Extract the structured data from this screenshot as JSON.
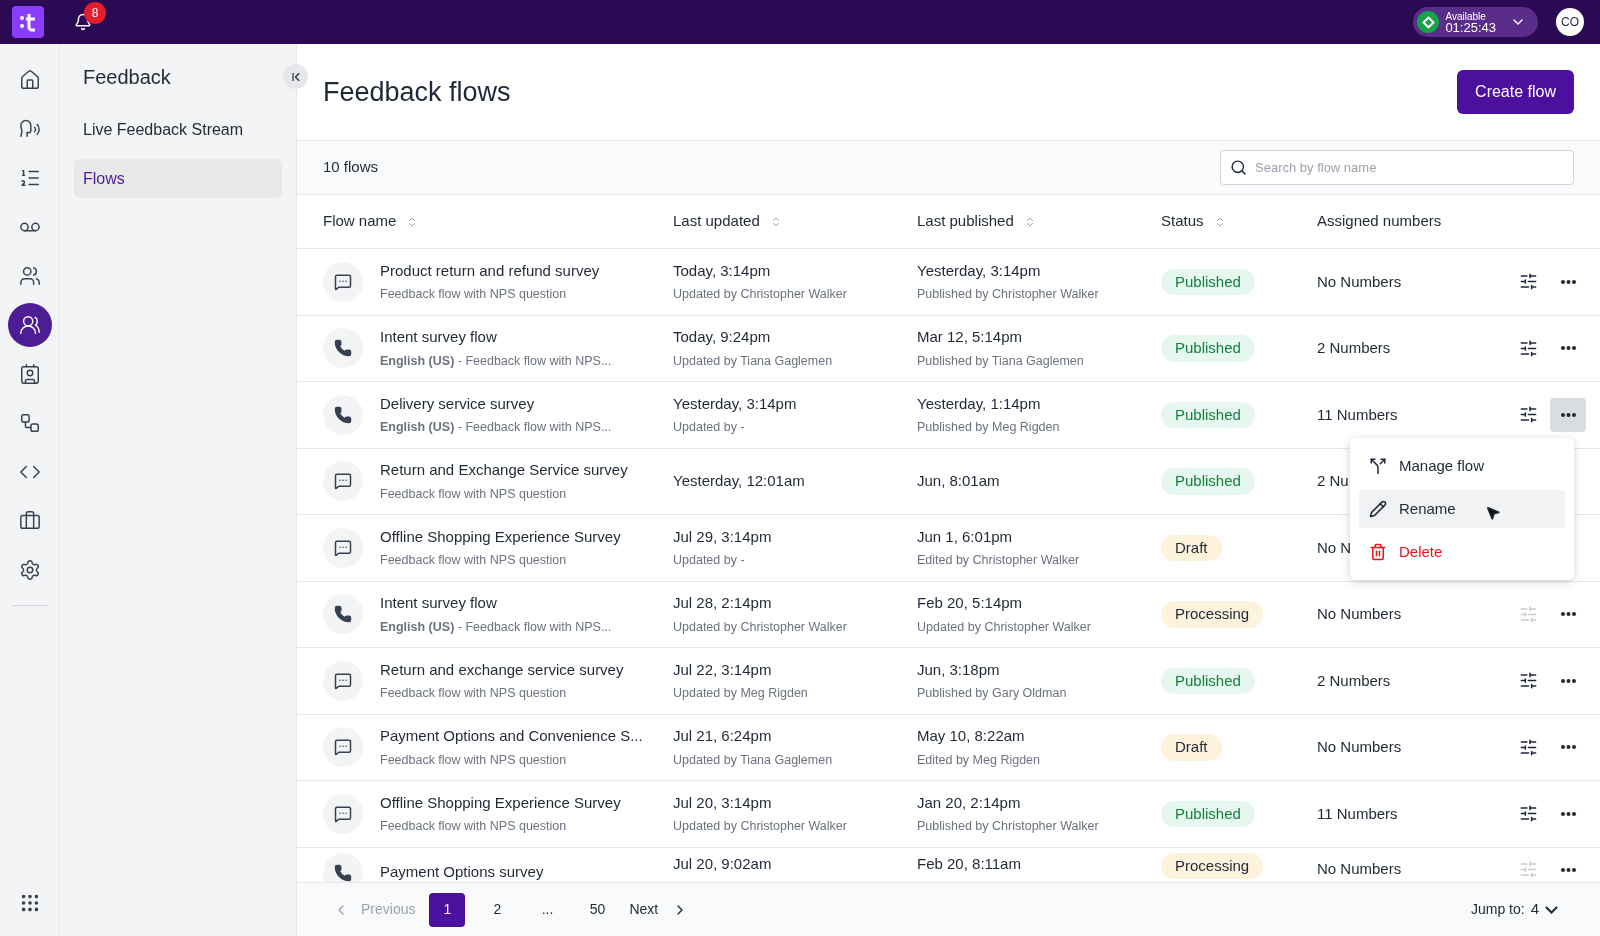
{
  "top_bar": {
    "notification_count": "8",
    "presence": {
      "label": "Available",
      "timer": "01:25:43"
    },
    "avatar": "CO"
  },
  "rail": {
    "items": [
      {
        "selected": false
      },
      {
        "selected": false
      },
      {
        "selected": false
      },
      {
        "selected": false
      },
      {
        "selected": false
      },
      {
        "selected": true
      },
      {
        "selected": false
      },
      {
        "selected": false
      },
      {
        "selected": false
      },
      {
        "selected": false
      },
      {
        "selected": false
      }
    ]
  },
  "sidebar": {
    "title": "Feedback",
    "items": [
      {
        "label": "Live Feedback Stream",
        "selected": false
      },
      {
        "label": "Flows",
        "selected": true
      }
    ]
  },
  "page": {
    "title": "Feedback flows",
    "create_button": "Create flow",
    "count": "10 flows",
    "search": {
      "placeholder": "Search by flow name"
    }
  },
  "table": {
    "columns": [
      {
        "label": "Flow name",
        "sortable": true
      },
      {
        "label": "Last updated",
        "sortable": true
      },
      {
        "label": "Last published",
        "sortable": true
      },
      {
        "label": "Status",
        "sortable": true
      },
      {
        "label": "Assigned numbers",
        "sortable": false
      }
    ],
    "rows": [
      {
        "kind": "chat",
        "name": "Product return and refund survey",
        "description": "Feedback flow with NPS question",
        "updated": "Today, 3:14pm",
        "updated_by": "Updated by Christopher Walker",
        "published": "Yesterday, 3:14pm",
        "published_by": "Published by Christopher Walker",
        "status": {
          "label": "Published",
          "kind": "published"
        },
        "numbers": "No Numbers",
        "settings_disabled": false,
        "menu_open": false
      },
      {
        "kind": "phone",
        "name": "Intent survey flow",
        "description": "**English (US)** - Feedback flow with NPS...",
        "updated": "Today, 9:24pm",
        "updated_by": "Updated by Tiana Gaglemen",
        "published": "Mar 12, 5:14pm",
        "published_by": "Published by Tiana Gaglemen",
        "status": {
          "label": "Published",
          "kind": "published"
        },
        "numbers": "2 Numbers",
        "settings_disabled": false,
        "menu_open": false
      },
      {
        "kind": "phone",
        "name": "Delivery service survey",
        "description": "**English (US)** - Feedback flow with NPS...",
        "updated": "Yesterday, 3:14pm",
        "updated_by": "Updated by -",
        "published": "Yesterday, 1:14pm",
        "published_by": "Published by Meg Rigden",
        "status": {
          "label": "Published",
          "kind": "published"
        },
        "numbers": "11 Numbers",
        "settings_disabled": false,
        "menu_open": true
      },
      {
        "kind": "chat",
        "name": "Return and Exchange Service survey",
        "description": "Feedback flow with NPS question",
        "updated": "Yesterday, 12:01am",
        "published": "Jun, 8:01am",
        "status": {
          "label": "Published",
          "kind": "published"
        },
        "numbers": "2 Nu"
      },
      {
        "kind": "chat",
        "name": "Offline Shopping Experience Survey",
        "description": "Feedback flow with NPS question",
        "updated": "Jul 29, 3:14pm",
        "updated_by": "Updated by -",
        "published": "Jun 1, 6:01pm",
        "published_by": "Edited by Christopher Walker",
        "status": {
          "label": "Draft",
          "kind": "draft"
        },
        "numbers": "No N"
      },
      {
        "kind": "phone",
        "name": "Intent survey flow",
        "description": "**English (US)** - Feedback flow with NPS...",
        "updated": "Jul 28, 2:14pm",
        "updated_by": "Updated by Christopher Walker",
        "published": "Feb 20, 5:14pm",
        "published_by": "Updated by Christopher Walker",
        "status": {
          "label": "Processing",
          "kind": "processing"
        },
        "numbers": "No Numbers",
        "settings_disabled": true,
        "menu_open": false
      },
      {
        "kind": "chat",
        "name": "Return and exchange service survey",
        "description": "Feedback flow with NPS question",
        "updated": "Jul 22, 3:14pm",
        "updated_by": "Updated by Meg Rigden",
        "published": "Jun, 3:18pm",
        "published_by": "Published by Gary Oldman",
        "status": {
          "label": "Published",
          "kind": "published"
        },
        "numbers": "2 Numbers",
        "settings_disabled": false,
        "menu_open": false
      },
      {
        "kind": "chat",
        "name": "Payment Options and Convenience S...",
        "description": "Feedback flow with NPS question",
        "updated": "Jul 21, 6:24pm",
        "updated_by": "Updated by Tiana Gaglemen",
        "published": "May 10, 8:22am",
        "published_by": "Edited by Meg Rigden",
        "status": {
          "label": "Draft",
          "kind": "draft"
        },
        "numbers": "No Numbers",
        "settings_disabled": false,
        "menu_open": false
      },
      {
        "kind": "chat",
        "name": "Offline Shopping Experience Survey",
        "description": "Feedback flow with NPS question",
        "updated": "Jul 20, 3:14pm",
        "updated_by": "Updated by Christopher Walker",
        "published": "Jan 20, 2:14pm",
        "published_by": "Published by Christopher Walker",
        "status": {
          "label": "Published",
          "kind": "published"
        },
        "numbers": "11 Numbers",
        "settings_disabled": false,
        "menu_open": false
      },
      {
        "kind": "phone",
        "name": "Payment Options survey",
        "updated": "Jul 20, 9:02am",
        "published": "Feb 20, 8:11am",
        "status": {
          "label": "Processing",
          "kind": "processing"
        },
        "numbers": "No Numbers",
        "settings_disabled": true,
        "menu_open": false
      }
    ]
  },
  "row_menu": {
    "items": [
      {
        "kind": "manage",
        "label": "Manage flow",
        "selected": false
      },
      {
        "kind": "rename",
        "label": "Rename",
        "selected": true
      },
      {
        "kind": "delete",
        "label": "Delete",
        "selected": false
      }
    ]
  },
  "pagination": {
    "previous": "Previous",
    "pages": [
      {
        "label": "1",
        "selected": true
      },
      {
        "label": "2",
        "selected": false
      },
      {
        "label": "...",
        "selected": false
      },
      {
        "label": "50",
        "selected": false
      }
    ],
    "next": "Next",
    "jump_label": "Jump to:",
    "jump_value": "4"
  }
}
